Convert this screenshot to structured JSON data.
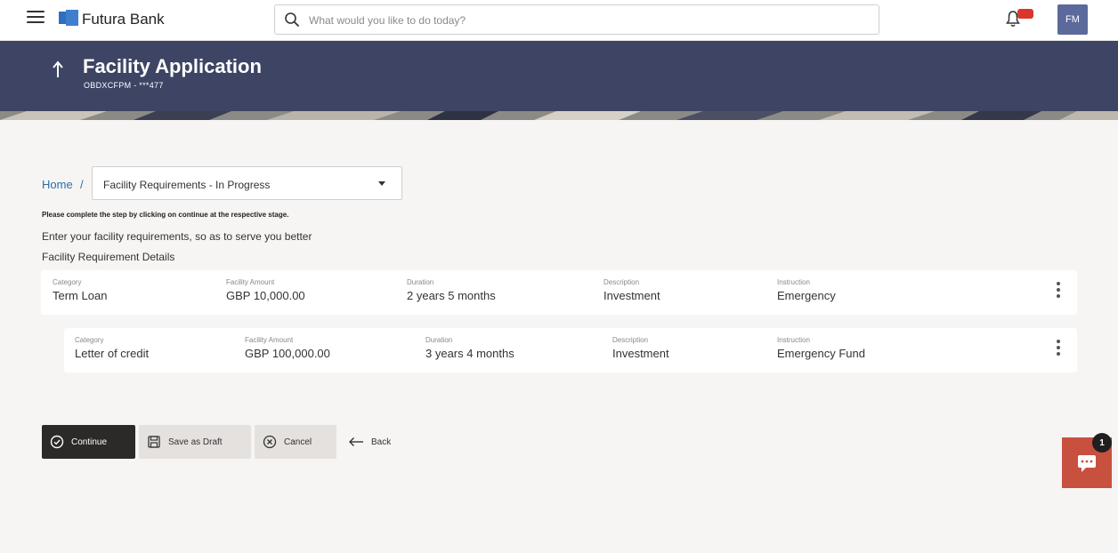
{
  "app": {
    "brand_name": "Futura Bank",
    "brand_color": "#2f6fc0",
    "icons": [
      "hamburger-menu-icon",
      "bank-logo-icon",
      "search-icon",
      "bell-icon",
      "arrow-up-icon",
      "check-circle-icon",
      "save-icon",
      "close-circle-icon",
      "arrow-left-icon",
      "kebab-menu-icon",
      "chat-icon"
    ]
  },
  "search": {
    "placeholder": "What would you like to do today?"
  },
  "user": {
    "initials": "FM"
  },
  "header": {
    "title": "Facility Application",
    "subtitle": "OBDXCFPM - ***477"
  },
  "breadcrumb": {
    "home": "Home",
    "separator": "/",
    "stage": "Facility Requirements - In Progress"
  },
  "instructions": {
    "note": "Please complete the step by clicking on continue at the respective stage.",
    "intro": "Enter your facility requirements, so as to serve you better",
    "section_title": "Facility Requirement Details"
  },
  "labels": {
    "category": "Category",
    "facility_amount": "Facility Amount",
    "duration": "Duration",
    "description": "Description",
    "instruction": "Instruction"
  },
  "facilities": [
    {
      "category": "Term Loan",
      "amount": "GBP 10,000.00",
      "duration": "2 years 5 months",
      "description": "Investment",
      "instruction": "Emergency"
    },
    {
      "category": "Letter of credit",
      "amount": "GBP 100,000.00",
      "duration": "3 years 4 months",
      "description": "Investment",
      "instruction": "Emergency Fund"
    }
  ],
  "actions": {
    "continue": "Continue",
    "save_draft": "Save as Draft",
    "cancel": "Cancel",
    "back": "Back"
  },
  "chat": {
    "count": "1"
  },
  "colors": {
    "banner": "#3d4464",
    "continue_button": "#2b2a29",
    "chat_widget": "#c8503e",
    "link": "#2b6ea6"
  }
}
